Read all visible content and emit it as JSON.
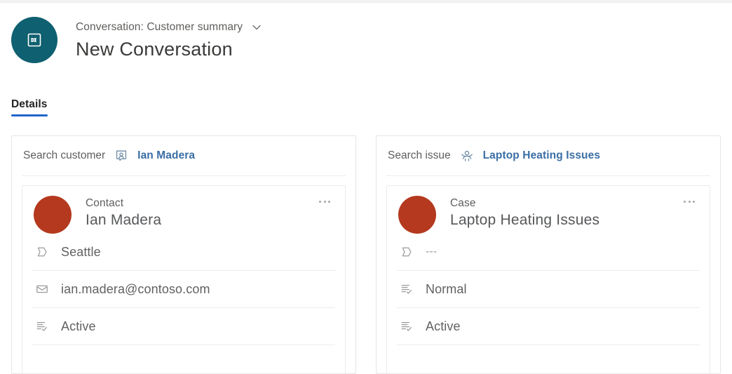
{
  "header": {
    "entity_icon": "conversation-icon",
    "breadcrumb": "Conversation: Customer summary",
    "chevron_icon": "chevron-down-icon",
    "title": "New Conversation",
    "avatar_color": "#0f6070"
  },
  "tabs": [
    {
      "label": "Details",
      "active": true
    }
  ],
  "accent_color": "#2266cc",
  "record_avatar_color": "#b4391e",
  "link_color": "#3a6ea5",
  "panels": [
    {
      "search": {
        "label": "Search customer",
        "icon": "contact-card-icon",
        "value": "Ian Madera"
      },
      "record": {
        "avatar": "record-avatar",
        "type": "Contact",
        "name": "Ian Madera",
        "overflow": "more-options",
        "fields": [
          {
            "icon": "tag-icon",
            "value": "Seattle",
            "muted": false
          },
          {
            "icon": "envelope-icon",
            "value": "ian.madera@contoso.com",
            "muted": false
          },
          {
            "icon": "status-list-icon",
            "value": "Active",
            "muted": false
          }
        ]
      }
    },
    {
      "search": {
        "label": "Search issue",
        "icon": "case-person-icon",
        "value": "Laptop Heating Issues"
      },
      "record": {
        "avatar": "record-avatar",
        "type": "Case",
        "name": "Laptop Heating Issues",
        "overflow": "more-options",
        "fields": [
          {
            "icon": "tag-icon",
            "value": "---",
            "muted": true
          },
          {
            "icon": "status-list-icon",
            "value": "Normal",
            "muted": false
          },
          {
            "icon": "status-list-icon",
            "value": "Active",
            "muted": false
          }
        ]
      }
    }
  ]
}
